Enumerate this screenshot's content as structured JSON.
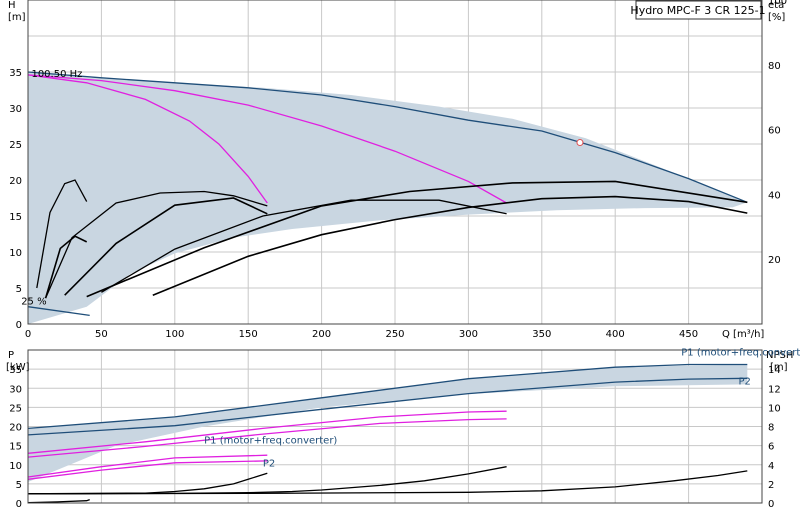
{
  "chart_data": [
    {
      "type": "line",
      "title": "Hydro MPC-F 3 CR 125-1",
      "xlabel": "Q [m³/h]",
      "ylabel": "H",
      "ylabel_unit": "[m]",
      "y2label": "eta",
      "y2label_unit": "[%]",
      "xlim": [
        0,
        500
      ],
      "ylim": [
        0,
        45
      ],
      "y2lim": [
        0,
        100
      ],
      "x_ticks": [
        "0",
        "50",
        "100",
        "150",
        "200",
        "250",
        "300",
        "350",
        "400",
        "450"
      ],
      "y_ticks": [
        "0",
        "5",
        "10",
        "15",
        "20",
        "25",
        "30",
        "35"
      ],
      "y2_ticks": [
        "20",
        "40",
        "60",
        "80",
        "100"
      ],
      "grid": true,
      "operating_point": {
        "x": 376,
        "y": 25.2
      },
      "annotations": [
        {
          "text": "100.50 Hz",
          "x": 1,
          "y": 34.3
        },
        {
          "text": "25 %",
          "x": -6,
          "y": 2.7
        }
      ],
      "colors": {
        "envelope_fill": "#c9d6e1",
        "dark_blue": "#1f4e79",
        "magenta": "#e020e0",
        "black": "#000000"
      },
      "series": [
        {
          "role": "envelope",
          "x": [
            0,
            40,
            100,
            160,
            220,
            280,
            330,
            380,
            430,
            490,
            480,
            420,
            360,
            300,
            240,
            180,
            140,
            100,
            70,
            40,
            0
          ],
          "y": [
            35,
            34.2,
            33.5,
            32.8,
            31.8,
            30.2,
            28.5,
            25.8,
            21.8,
            16.9,
            16.2,
            16.1,
            15.8,
            15.2,
            14.4,
            13.2,
            12,
            9.8,
            7,
            2.4,
            0
          ]
        },
        {
          "role": "head",
          "color": "dark_blue",
          "x": [
            0,
            50,
            100,
            150,
            200,
            250,
            300,
            350,
            400,
            450,
            490
          ],
          "y": [
            35,
            34.2,
            33.5,
            32.8,
            31.8,
            30.2,
            28.3,
            26.8,
            23.8,
            20.2,
            16.9
          ]
        },
        {
          "role": "head",
          "color": "magenta",
          "x": [
            0,
            50,
            100,
            150,
            200,
            250,
            300,
            326
          ],
          "y": [
            34.6,
            33.8,
            32.4,
            30.4,
            27.5,
            24,
            19.8,
            16.8
          ]
        },
        {
          "role": "head",
          "color": "magenta",
          "x": [
            0,
            40,
            80,
            110,
            130,
            150,
            163
          ],
          "y": [
            34.6,
            33.5,
            31.2,
            28.2,
            25,
            20.5,
            16.8
          ]
        },
        {
          "role": "efficiency",
          "color": "black",
          "x": [
            85,
            150,
            200,
            250,
            300,
            350,
            400,
            450,
            490
          ],
          "y": [
            4,
            9.4,
            12.4,
            14.5,
            16.2,
            17.4,
            17.7,
            17,
            15.4
          ]
        },
        {
          "role": "efficiency",
          "color": "black",
          "x": [
            50,
            100,
            160,
            220,
            280,
            326
          ],
          "y": [
            4.4,
            10.4,
            15,
            17.2,
            17.2,
            15.3
          ]
        },
        {
          "role": "efficiency",
          "color": "black",
          "x": [
            25,
            60,
            100,
            140,
            163
          ],
          "y": [
            4,
            11.2,
            16.5,
            17.5,
            15.3
          ]
        },
        {
          "role": "efficiency",
          "color": "black",
          "x": [
            12,
            30,
            60,
            90,
            120,
            140,
            163
          ],
          "y": [
            3.6,
            12,
            16.8,
            18.2,
            18.4,
            17.8,
            16.4
          ]
        },
        {
          "role": "efficiency",
          "color": "black",
          "x": [
            12,
            22,
            32,
            40
          ],
          "y": [
            3.6,
            10.5,
            12.2,
            11.4
          ]
        },
        {
          "role": "efficiency",
          "color": "black",
          "x": [
            6,
            15,
            25,
            32,
            40
          ],
          "y": [
            5,
            15.5,
            19.5,
            20,
            17
          ]
        },
        {
          "role": "efficiency",
          "color": "black",
          "x": [
            40,
            120,
            200,
            260,
            330,
            400,
            490
          ],
          "y": [
            3.8,
            10.6,
            16.4,
            18.4,
            19.6,
            19.8,
            16.9
          ]
        },
        {
          "role": "curve",
          "color": "dark_blue",
          "x": [
            0,
            42
          ],
          "y": [
            2.4,
            1.2
          ]
        }
      ]
    },
    {
      "type": "line",
      "xlim": [
        0,
        500
      ],
      "ylabel": "P",
      "ylabel_unit": "[kW]",
      "y2label": "NPSH",
      "y2label_unit": "[m]",
      "ylim": [
        0,
        40
      ],
      "y2lim": [
        0,
        16
      ],
      "y_ticks": [
        "0",
        "5",
        "10",
        "15",
        "20",
        "25",
        "30",
        "35"
      ],
      "y2_ticks": [
        "0",
        "2",
        "4",
        "6",
        "8",
        "10",
        "12",
        "14"
      ],
      "grid": true,
      "labels": [
        {
          "text": "P1 (motor+freq.converter)",
          "x": 445,
          "y": 38.5,
          "color": "dark_blue"
        },
        {
          "text": "P2",
          "x": 484,
          "y": 31,
          "color": "dark_blue"
        },
        {
          "text": "P1 (motor+freq.converter)",
          "x": 120,
          "y": 15.5,
          "color": "dark_blue"
        },
        {
          "text": "P2",
          "x": 160,
          "y": 9.5,
          "color": "dark_blue"
        }
      ],
      "series": [
        {
          "role": "envelope",
          "x": [
            0,
            100,
            200,
            300,
            400,
            490,
            490,
            400,
            300,
            200,
            120,
            60,
            0
          ],
          "y": [
            19.5,
            22.5,
            27.5,
            32.5,
            35.5,
            36.2,
            31,
            30.5,
            28.5,
            25,
            20,
            15,
            5.5
          ]
        },
        {
          "role": "power",
          "color": "dark_blue",
          "x": [
            0,
            100,
            200,
            300,
            400,
            450,
            490
          ],
          "y": [
            19.5,
            22.5,
            27.5,
            32.5,
            35.5,
            36.2,
            36.2
          ]
        },
        {
          "role": "power",
          "color": "dark_blue",
          "x": [
            0,
            100,
            200,
            300,
            400,
            450,
            490
          ],
          "y": [
            17.8,
            20.2,
            24.5,
            28.6,
            31.6,
            32.4,
            32.6
          ]
        },
        {
          "role": "power",
          "color": "magenta",
          "x": [
            0,
            80,
            160,
            240,
            300,
            326
          ],
          "y": [
            13,
            16,
            19.5,
            22.5,
            23.8,
            24
          ]
        },
        {
          "role": "power",
          "color": "magenta",
          "x": [
            0,
            80,
            160,
            240,
            300,
            326
          ],
          "y": [
            12,
            14.8,
            18,
            20.8,
            21.8,
            22
          ]
        },
        {
          "role": "power",
          "color": "magenta",
          "x": [
            0,
            50,
            100,
            163
          ],
          "y": [
            6.8,
            9.5,
            11.8,
            12.5
          ]
        },
        {
          "role": "power",
          "color": "magenta",
          "x": [
            0,
            50,
            100,
            163
          ],
          "y": [
            6.2,
            8.6,
            10.5,
            11
          ]
        },
        {
          "role": "npsh",
          "color": "black",
          "x": [
            0,
            100,
            150,
            180,
            200,
            240,
            270,
            300,
            326
          ],
          "y": [
            2.4,
            2.5,
            2.7,
            3,
            3.4,
            4.6,
            5.8,
            7.6,
            9.5
          ]
        },
        {
          "role": "npsh",
          "color": "black",
          "x": [
            0,
            150,
            300,
            350,
            400,
            440,
            470,
            490
          ],
          "y": [
            2.4,
            2.5,
            2.8,
            3.2,
            4.2,
            5.8,
            7.2,
            8.4
          ]
        },
        {
          "role": "npsh",
          "color": "black",
          "x": [
            0,
            80,
            100,
            120,
            140,
            150,
            163
          ],
          "y": [
            2.4,
            2.6,
            3,
            3.7,
            5,
            6.2,
            7.8
          ]
        },
        {
          "role": "npsh",
          "color": "black",
          "x": [
            0,
            20,
            40,
            42
          ],
          "y": [
            0.1,
            0.3,
            0.6,
            0.9
          ]
        }
      ]
    }
  ]
}
